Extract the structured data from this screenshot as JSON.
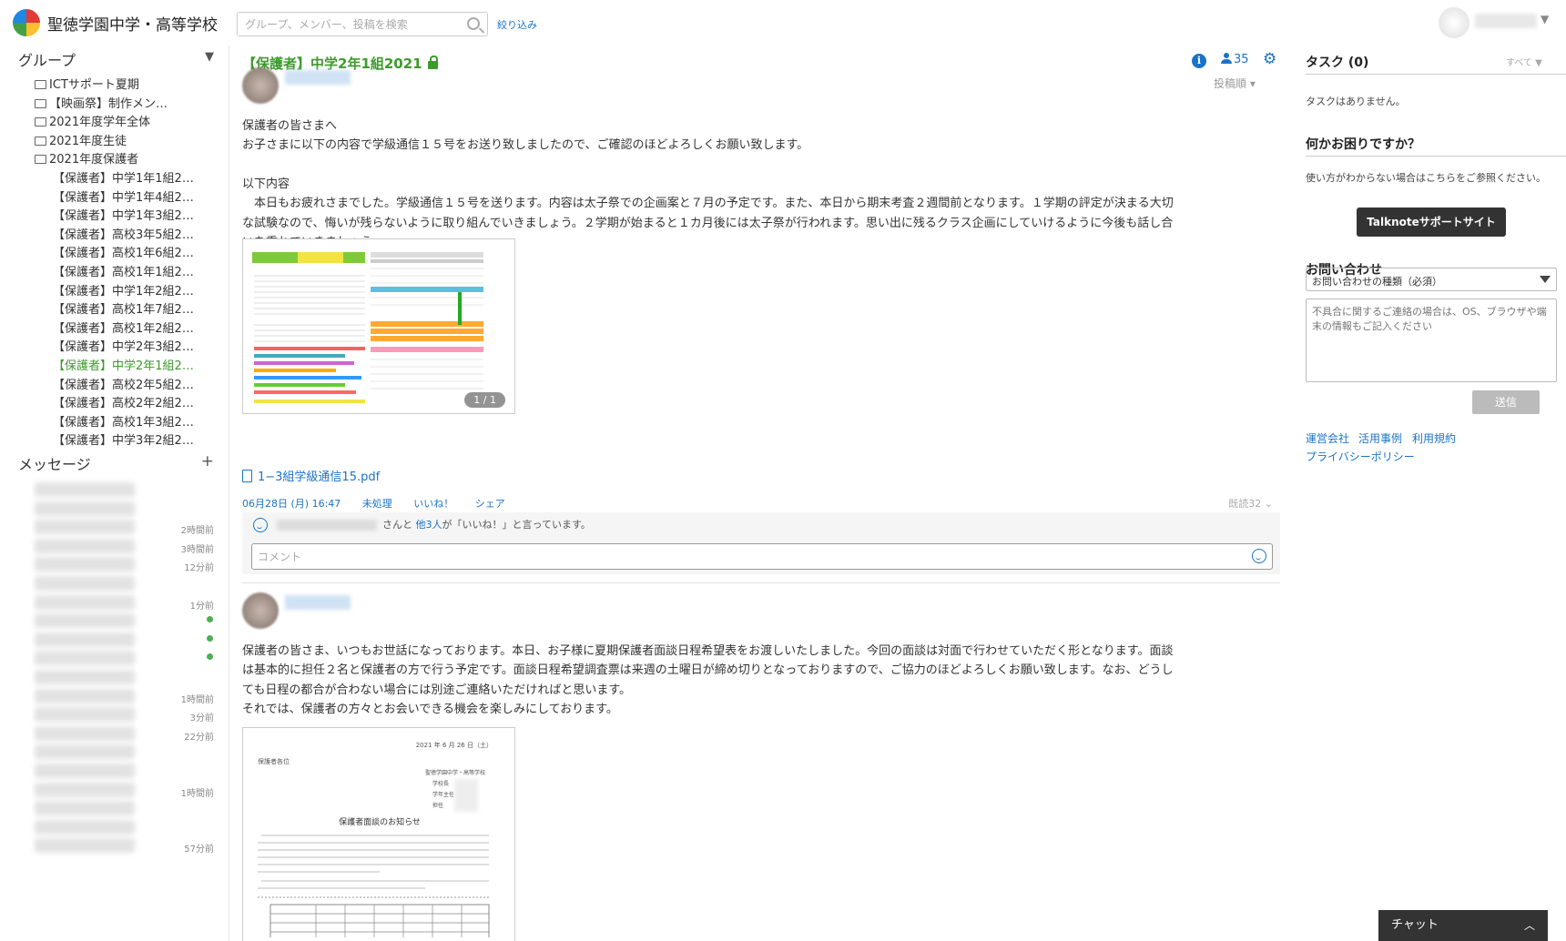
{
  "header": {
    "school_name": "聖徳学園中学・高等学校",
    "search_placeholder": "グループ、メンバー、投稿を検索",
    "filter_label": "絞り込み",
    "user_caret": "▼"
  },
  "sidebar": {
    "groups_title": "グループ",
    "groups_toggle": "▼",
    "folders": [
      "ICTサポート夏期",
      "【映画祭】制作メン…",
      "2021年度学年全体",
      "2021年度生徒",
      "2021年度保護者"
    ],
    "subgroups": [
      "【保護者】中学1年1組2…",
      "【保護者】中学1年4組2…",
      "【保護者】中学1年3組2…",
      "【保護者】高校3年5組2…",
      "【保護者】高校1年6組2…",
      "【保護者】高校1年1組2…",
      "【保護者】中学1年2組2…",
      "【保護者】高校1年7組2…",
      "【保護者】高校1年2組2…",
      "【保護者】中学2年3組2…",
      "【保護者】中学2年1組2…",
      "【保護者】高校2年5組2…",
      "【保護者】高校2年2組2…",
      "【保護者】高校1年3組2…",
      "【保護者】中学3年2組2…"
    ],
    "active_index": 10,
    "messages_title": "メッセージ",
    "messages_add": "+",
    "message_times": [
      "",
      "",
      "2時間前",
      "3時間前",
      "12分前",
      "",
      "1分前",
      "",
      "",
      "",
      "",
      "1時間前",
      "3分前",
      "22分前",
      "",
      "",
      "1時間前",
      "",
      "",
      "57分前"
    ],
    "unread_dots": [
      7,
      8,
      9
    ]
  },
  "main": {
    "group_title": "【保護者】中学2年1組2021",
    "member_count": "35",
    "info_icon": "i",
    "gear_icon": "⚙",
    "sort_label": "投稿順 ▾",
    "post1": {
      "lines": [
        "保護者の皆さまへ",
        "お子さまに以下の内容で学級通信１５号をお送り致しましたので、ご確認のほどよろしくお願い致します。",
        "",
        "以下内容",
        "　本日もお疲れさまでした。学級通信１５号を送ります。内容は太子祭での企画案と７月の予定です。また、本日から期末考査２週間前となります。１学期の評定が決まる大切",
        "な試験なので、悔いが残らないように取り組んでいきましょう。２学期が始まると１カ月後には太子祭が行われます。思い出に残るクラス企画にしていけるように今後も話し合",
        "いを重ねていきましょう。"
      ],
      "page_badge": "1 / 1",
      "attachment": "1−3組学級通信15.pdf",
      "date": "06月28日 (月) 16:47",
      "status": "未処理",
      "like": "いいね！",
      "share": "シェア",
      "read_count": "既読32",
      "like_suffix": "さんと",
      "like_others": "他3人",
      "like_tail": "が「いいね！」と言っています。",
      "comment_placeholder": "コメント"
    },
    "post2": {
      "lines": [
        "保護者の皆さま、いつもお世話になっております。本日、お子様に夏期保護者面談日程希望表をお渡しいたしました。今回の面談は対面で行わせていただく形となります。面談",
        "は基本的に担任２名と保護者の方で行う予定です。面談日程希望調査票は来週の土曜日が締め切りとなっておりますので、ご協力のほどよろしくお願い致します。なお、どうし",
        "ても日程の都合が合わない場合には別途ご連絡いただければと思います。",
        "それでは、保護者の方々とお会いできる機会を楽しみにしております。"
      ],
      "doc_date": "2021 年 6 月 26 日（土）",
      "doc_to": "保護者各位",
      "doc_from": [
        "聖徳学園中学・高等学校",
        "学校長",
        "学年主任",
        "担任"
      ],
      "doc_title": "保護者面談のお知らせ"
    }
  },
  "right": {
    "task_title": "タスク (0)",
    "task_filter": "すべて ▼",
    "no_tasks": "タスクはありません。",
    "help_title": "何かお困りですか？",
    "help_text": "使い方がわからない場合はこちらをご参照ください。",
    "support_button": "Talknoteサポートサイト",
    "contact_title": "お問い合わせ",
    "contact_select": "お問い合わせの種類（必須）",
    "contact_placeholder": "不具合に関するご連絡の場合は、OS、ブラウザや端末の情報もご記入ください",
    "send_button": "送信",
    "links": [
      "運営会社",
      "活用事例",
      "利用規約",
      "プライバシーポリシー"
    ]
  },
  "chat": {
    "label": "チャット",
    "chevron": "︿"
  },
  "colors": {
    "accent_green": "#3d9a2c",
    "link_blue": "#1a73c8"
  }
}
